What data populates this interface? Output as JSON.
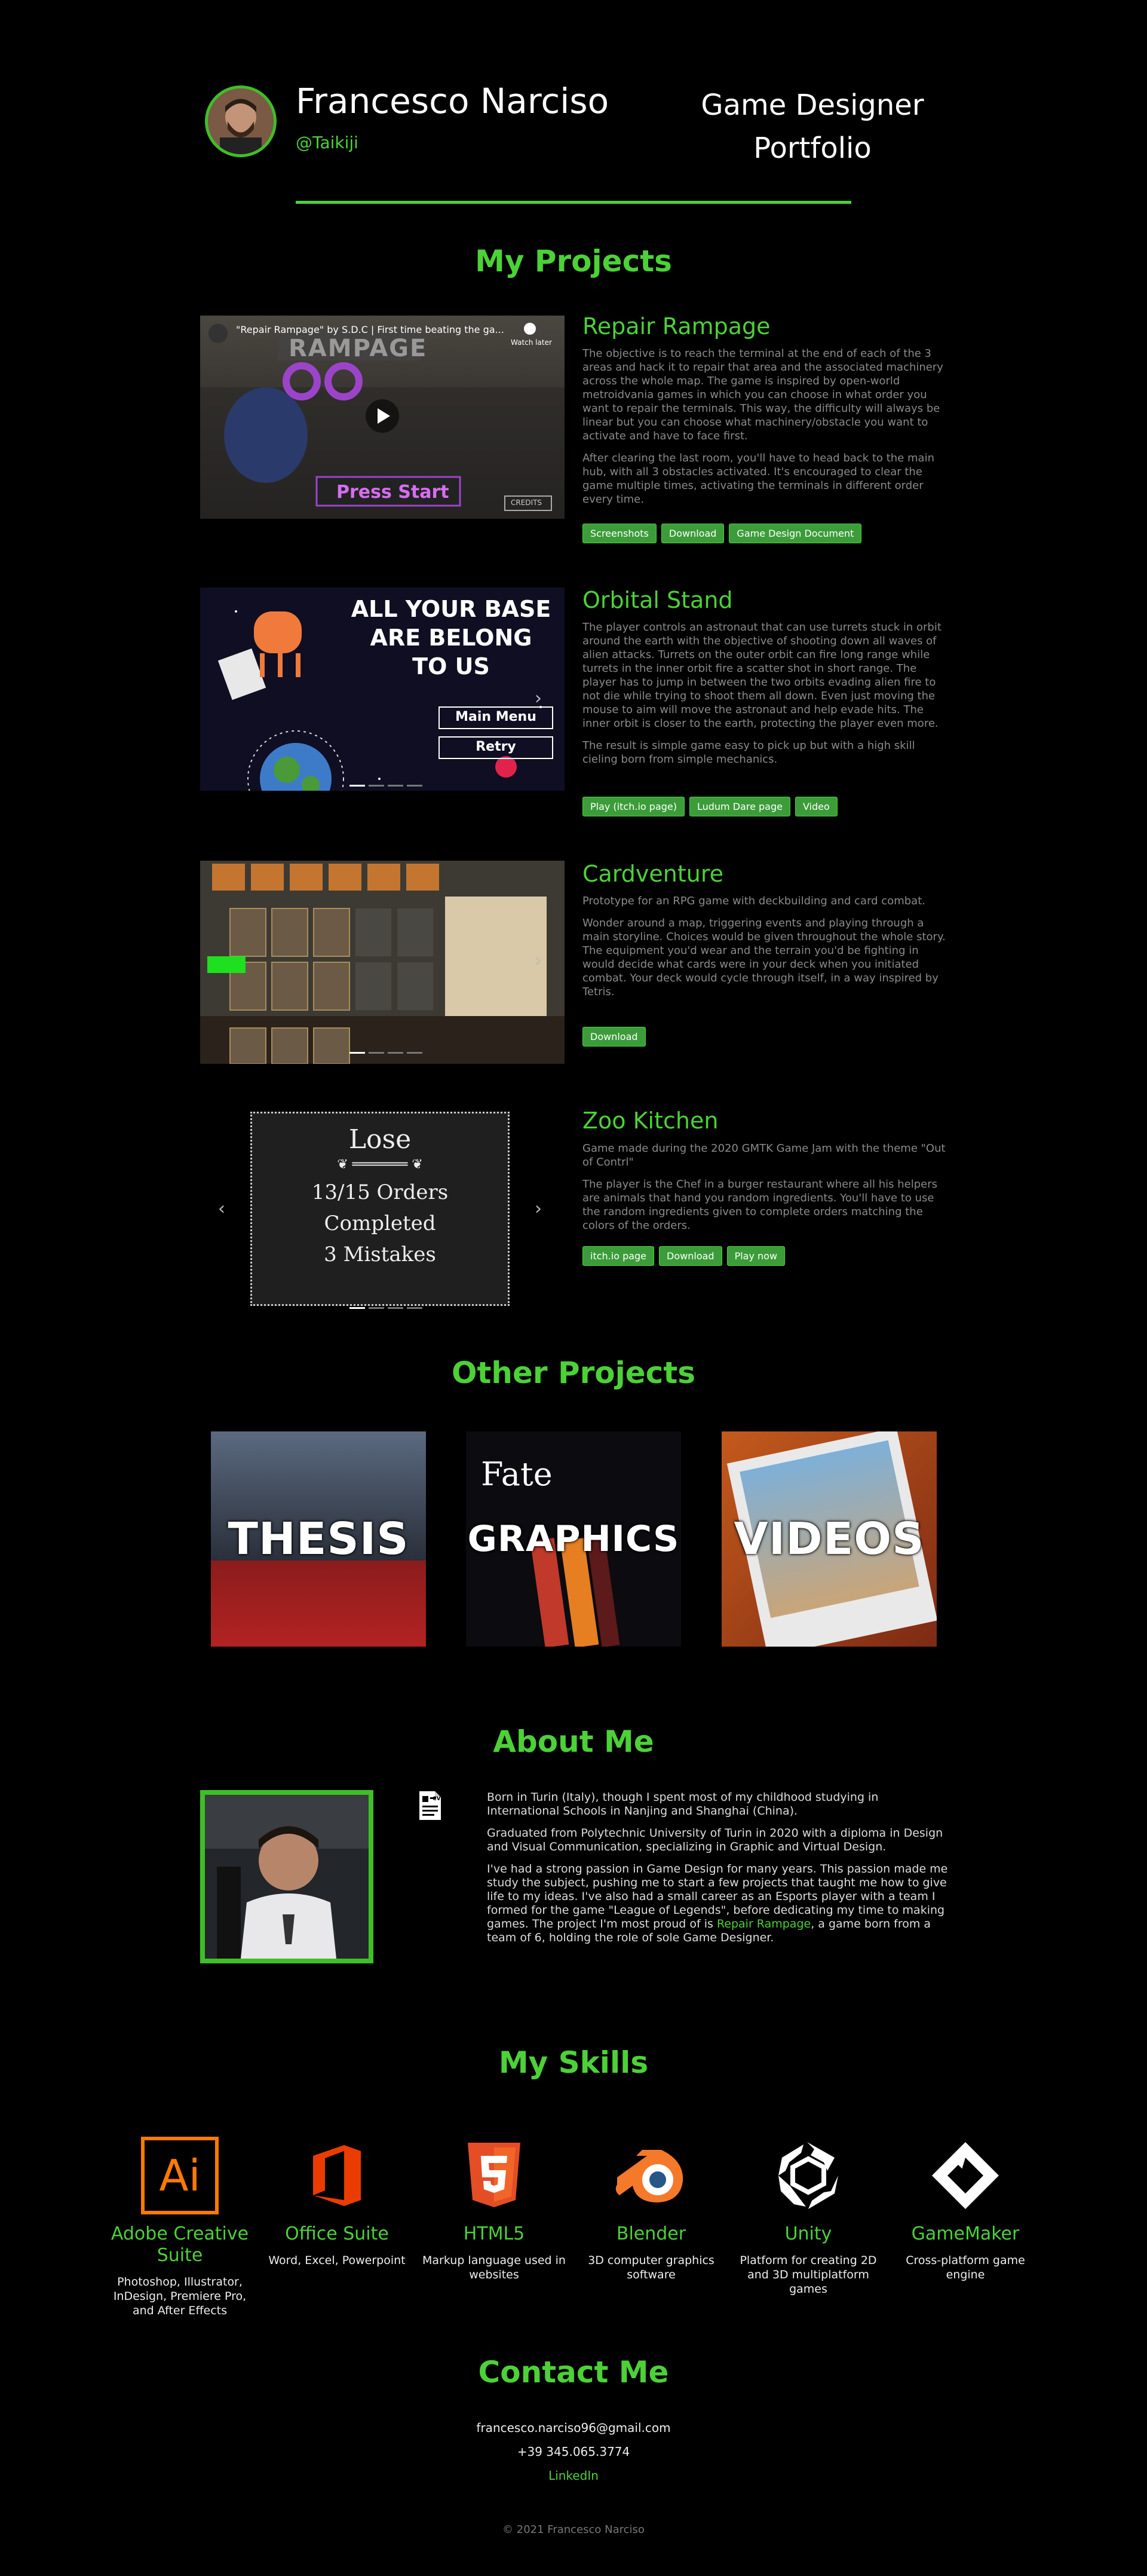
{
  "header": {
    "name": "Francesco Narciso",
    "handle": "@Taikiji",
    "role_line1": "Game Designer",
    "role_line2": "Portfolio"
  },
  "projects_section": {
    "title": "My Projects",
    "items": [
      {
        "title": "Repair Rampage",
        "video_title": "\"Repair Rampage\" by S.D.C | First time beating the ga...",
        "watch_later": "Watch later",
        "game_logo": "RAMPAGE",
        "press_start": "Press Start",
        "credits": "CREDITS",
        "desc1": "The objective is to reach the terminal at the end of each of the 3 areas and hack it to repair that area and the associated machinery across the whole map. The game is inspired by open-world metroidvania games in which you can choose in what order you want to repair the terminals. This way, the difficulty will always be linear but you can choose what machinery/obstacle you want to activate and have to face first.",
        "desc2": "After clearing the last room, you'll have to head back to the main hub, with all 3 obstacles activated. It's encouraged to clear the game multiple times, activating the terminals in different order every time.",
        "buttons": [
          "Screenshots",
          "Download",
          "Game Design Document"
        ]
      },
      {
        "title": "Orbital Stand",
        "screen_line1": "ALL YOUR BASE",
        "screen_line2": "ARE BELONG",
        "screen_line3": "TO US",
        "main_menu": "Main Menu",
        "retry": "Retry",
        "desc1": "The player controls an astronaut that can use turrets stuck in orbit around the earth with the objective of shooting down all waves of alien attacks. Turrets on the outer orbit can fire long range while turrets in the inner orbit fire a scatter shot in short range. The player has to jump in between the two orbits evading alien fire to not die while trying to shoot them all down. Even just moving the mouse to aim will move the astronaut and help evade hits. The inner orbit is closer to the earth, protecting the player even more.",
        "desc2": "The result is simple game easy to pick up but with a high skill cieling born from simple mechanics.",
        "buttons": [
          "Play (itch.io page)",
          "Ludum Dare page",
          "Video"
        ]
      },
      {
        "title": "Cardventure",
        "desc1": "Prototype for an RPG game with deckbuilding and card combat.",
        "desc2": "Wonder around a map, triggering events and playing through a main storyline. Choices would be given throughout the whole story. The equipment you'd wear and the terrain you'd be fighting in would decide what cards were in your deck when you initiated combat. Your deck would cycle through itself, in a way inspired by Tetris.",
        "buttons": [
          "Download"
        ]
      },
      {
        "title": "Zoo Kitchen",
        "screen_title": "Lose",
        "screen_line1": "13/15 Orders",
        "screen_line2": "Completed",
        "screen_line3": "3 Mistakes",
        "desc1": "Game made during the 2020 GMTK Game Jam with the theme \"Out of Contrl\"",
        "desc2": "The player is the Chef in a burger restaurant where all his helpers are animals that hand you random ingredients. You'll have to use the random ingredients given to complete orders matching the colors of the orders.",
        "buttons": [
          "itch.io page",
          "Download",
          "Play now"
        ]
      }
    ]
  },
  "other_section": {
    "title": "Other Projects",
    "tiles": [
      "THESIS",
      "GRAPHICS",
      "VIDEOS"
    ],
    "graphics_caption": "Fate"
  },
  "about_section": {
    "title": "About Me",
    "p1": "Born in Turin (Italy), though I spent most of my childhood studying in International Schools in Nanjing and Shanghai (China).",
    "p2": "Graduated from Polytechnic University of Turin in 2020 with a diploma in Design and Visual Communication, specializing in Graphic and Virtual Design.",
    "p3_before": "I've had a strong passion in Game Design for many years. This passion made me study the subject, pushing me to start a few projects that taught me how to give life to my ideas. I've also had a small career as an Esports player with a team I formed for the game \"League of Legends\", before dedicating my time to making games. The project I'm most proud of is ",
    "p3_link": "Repair Rampage",
    "p3_after": ", a game born from a team of 6, holding the role of sole Game Designer.",
    "cv_label": "CV"
  },
  "skills_section": {
    "title": "My Skills",
    "items": [
      {
        "name": "Adobe Creative Suite",
        "desc": "Photoshop, Illustrator, InDesign, Premiere Pro, and After Effects",
        "icon_text": "Ai"
      },
      {
        "name": "Office Suite",
        "desc": "Word, Excel, Powerpoint",
        "icon_text": ""
      },
      {
        "name": "HTML5",
        "desc": "Markup language used in websites",
        "icon_text": "5"
      },
      {
        "name": "Blender",
        "desc": "3D computer graphics software",
        "icon_text": ""
      },
      {
        "name": "Unity",
        "desc": "Platform for creating 2D and 3D multiplatform games",
        "icon_text": ""
      },
      {
        "name": "GameMaker",
        "desc": "Cross-platform game engine",
        "icon_text": ""
      }
    ]
  },
  "contact_section": {
    "title": "Contact Me",
    "email": "francesco.narciso96@gmail.com",
    "phone": "+39 345.065.3774",
    "linkedin": "LinkedIn"
  },
  "footer": {
    "text": "© 2021 Francesco Narciso"
  },
  "colors": {
    "accent": "#4cd137",
    "background": "#000000",
    "button": "#3c9c3a",
    "muted_text": "#8a8a8a"
  }
}
